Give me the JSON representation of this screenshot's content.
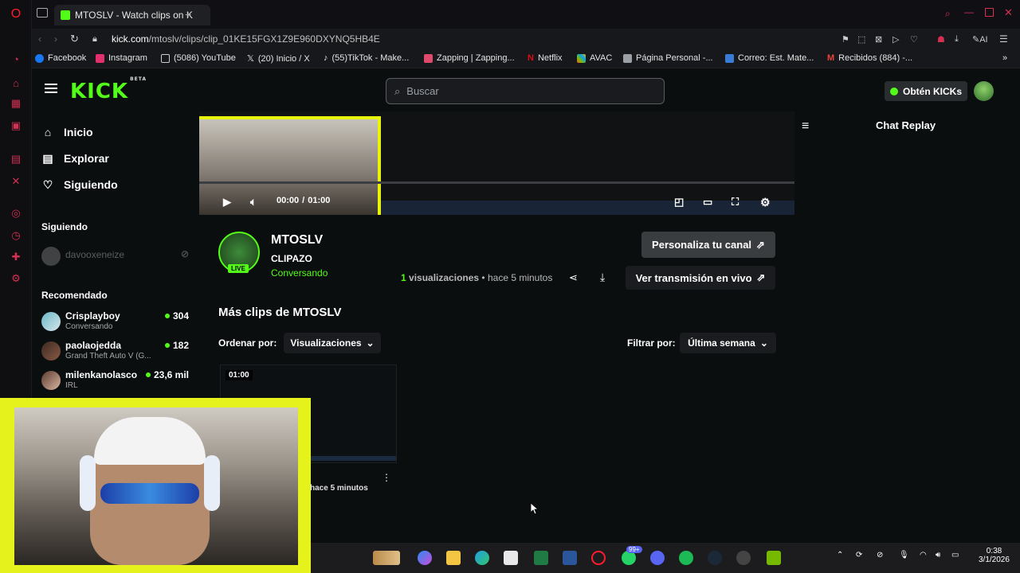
{
  "browser": {
    "tab_title": "MTOSLV - Watch clips on K",
    "url_domain": "kick.com",
    "url_path": "/mtoslv/clips/clip_01KE15FGX1Z9E960DXYNQ5HB4E",
    "bookmarks": [
      {
        "label": "Facebook",
        "color": "#1877f2"
      },
      {
        "label": "Instagram",
        "color": "#e1306c"
      },
      {
        "label": "(5086) YouTube",
        "color": "#cccccc"
      },
      {
        "label": "(20) Inicio / X",
        "color": "#ffffff"
      },
      {
        "label": "(55)TikTok - Make...",
        "color": "#ffffff"
      },
      {
        "label": "Zapping | Zapping...",
        "color": "#e04a6a"
      },
      {
        "label": "Netflix",
        "color": "#e50914"
      },
      {
        "label": "AVAC",
        "color": "#f4b400"
      },
      {
        "label": "Página Personal -...",
        "color": "#9aa0a6"
      },
      {
        "label": "Correo: Est. Mate...",
        "color": "#3a7bd5"
      },
      {
        "label": "Recibidos (884) -...",
        "color": "#ea4335"
      }
    ]
  },
  "kick": {
    "logo": "KICK",
    "logo_badge": "BETA",
    "search_placeholder": "Buscar",
    "obten_label": "Obtén KICKs",
    "nav": [
      {
        "label": "Inicio",
        "icon": "home-icon"
      },
      {
        "label": "Explorar",
        "icon": "explore-icon"
      },
      {
        "label": "Siguiendo",
        "icon": "heart-icon"
      }
    ],
    "following_heading": "Siguiendo",
    "following": [
      {
        "name": "davooxeneize"
      }
    ],
    "recommended_heading": "Recomendado",
    "recommended": [
      {
        "name": "Crisplayboy",
        "category": "Conversando",
        "viewers": "304"
      },
      {
        "name": "paolaojedda",
        "category": "Grand Theft Auto V (G...",
        "viewers": "182"
      },
      {
        "name": "milenkanolasco",
        "category": "IRL",
        "viewers": "23,6 mil"
      }
    ],
    "player": {
      "current": "00:00",
      "separator": "/",
      "duration": "01:00",
      "progress": 0.0
    },
    "chat_title": "Chat Replay",
    "channel": {
      "name": "MTOSLV",
      "clip_title": "CLIPAZO",
      "category": "Conversando",
      "live_label": "LIVE",
      "views_count": "1",
      "views_label": "visualizaciones",
      "dot": "•",
      "time_ago": "hace 5 minutos",
      "customize_label": "Personaliza tu canal",
      "watch_live_label": "Ver transmisión en vivo"
    },
    "more_clips_heading": "Más clips de MTOSLV",
    "sort_label": "Ordenar por:",
    "sort_value": "Visualizaciones",
    "filter_label": "Filtrar por:",
    "filter_value": "Última semana",
    "clips": [
      {
        "duration": "01:00",
        "time_ago": "hace 5 minutos"
      }
    ]
  },
  "taskbar": {
    "clock_time": "0:38",
    "clock_date": "3/1/2026",
    "badge_count": "99+"
  },
  "colors": {
    "accent": "#53fc18",
    "webcam_frame": "#e6f21c",
    "opera_red": "#d62f52"
  }
}
